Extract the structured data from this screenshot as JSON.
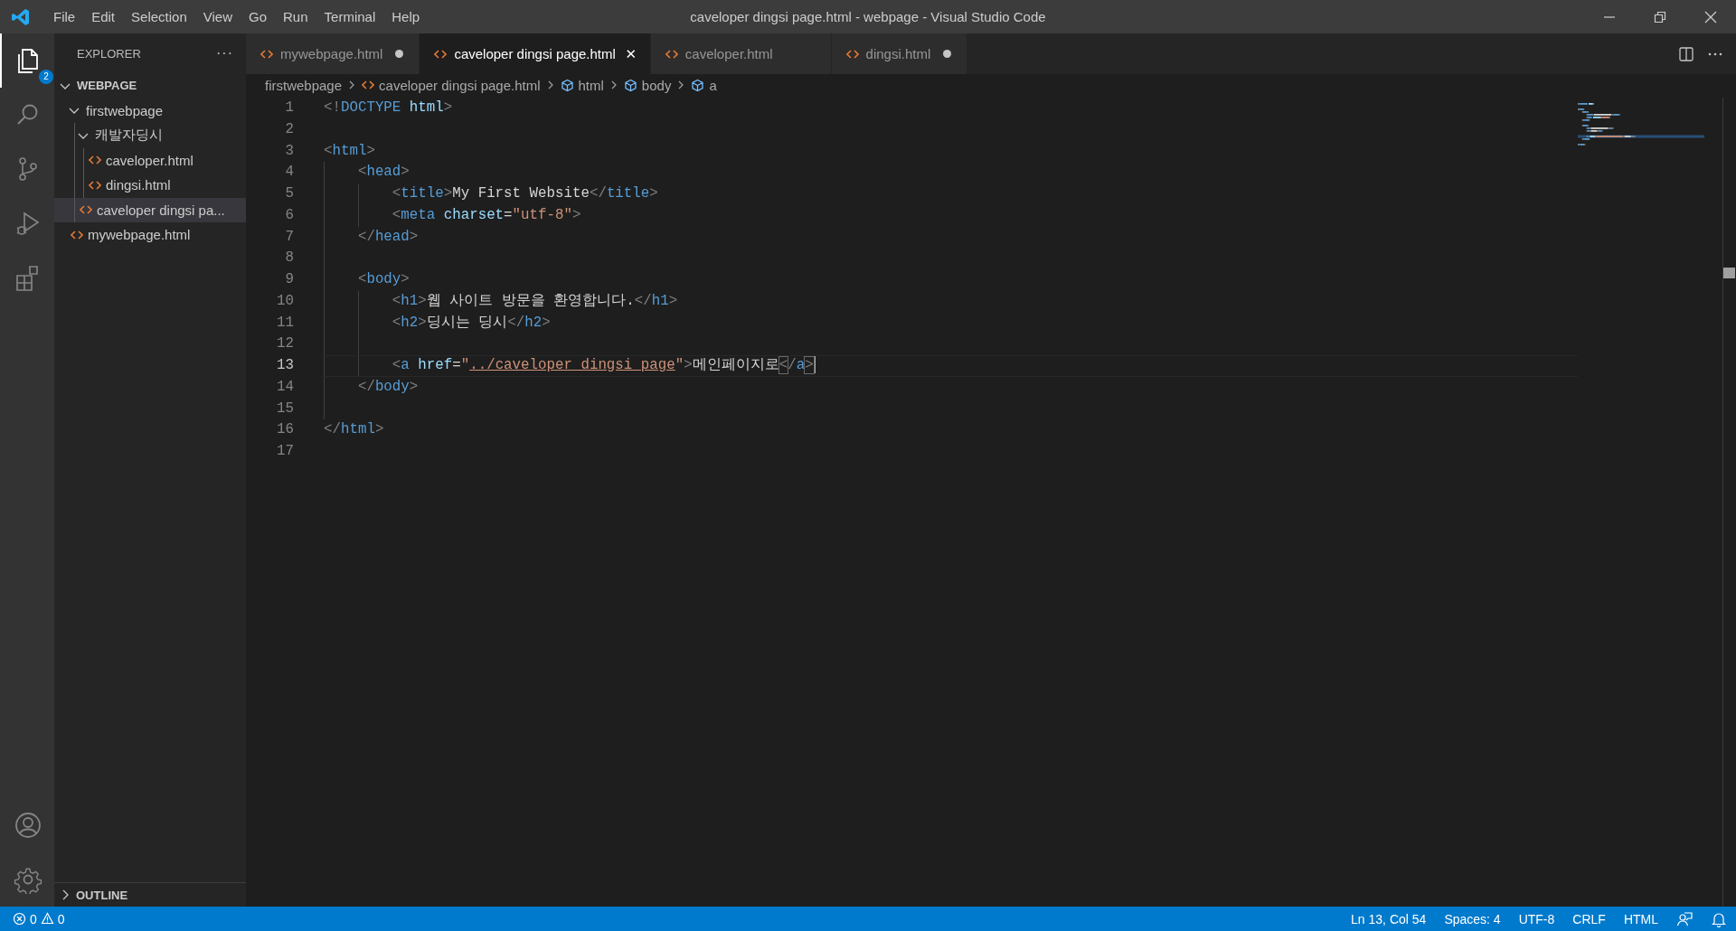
{
  "window": {
    "title": "caveloper dingsi page.html - webpage - Visual Studio Code"
  },
  "menu": [
    "File",
    "Edit",
    "Selection",
    "View",
    "Go",
    "Run",
    "Terminal",
    "Help"
  ],
  "activity_bar": {
    "top": [
      {
        "kind": "files",
        "selected": true,
        "badge": "2"
      },
      {
        "kind": "search",
        "selected": false
      },
      {
        "kind": "source-control",
        "selected": false
      },
      {
        "kind": "run",
        "selected": false
      },
      {
        "kind": "extensions",
        "selected": false
      }
    ],
    "bottom": [
      {
        "kind": "account"
      },
      {
        "kind": "settings"
      }
    ]
  },
  "sidebar": {
    "title": "EXPLORER",
    "more": "···",
    "section": {
      "label": "WEBPAGE",
      "expanded": true
    },
    "items": [
      {
        "kind": "folder",
        "label": "firstwebpage",
        "expanded": true,
        "selected": false,
        "children": [
          {
            "kind": "folder",
            "label": "캐발자딩시",
            "expanded": true,
            "selected": false,
            "children": [
              {
                "kind": "file",
                "label": "caveloper.html",
                "selected": false
              },
              {
                "kind": "file",
                "label": "dingsi.html",
                "selected": false
              }
            ]
          },
          {
            "kind": "file",
            "label": "caveloper dingsi pa...",
            "selected": true
          }
        ]
      },
      {
        "kind": "file",
        "label": "mywebpage.html",
        "selected": false
      }
    ],
    "outline": {
      "label": "OUTLINE",
      "expanded": false
    }
  },
  "tabs": [
    {
      "label": "mywebpage.html",
      "selected": false,
      "dirty": true
    },
    {
      "label": "caveloper dingsi page.html",
      "selected": true,
      "dirty": false,
      "close": "✕"
    },
    {
      "label": "caveloper.html",
      "selected": false,
      "dirty": false
    },
    {
      "label": "dingsi.html",
      "selected": false,
      "dirty": true
    }
  ],
  "breadcrumbs": [
    {
      "kind": "folder",
      "label": "firstwebpage"
    },
    {
      "kind": "file",
      "label": "caveloper dingsi page.html"
    },
    {
      "kind": "symbol",
      "label": "html"
    },
    {
      "kind": "symbol",
      "label": "body"
    },
    {
      "kind": "symbol",
      "label": "a"
    }
  ],
  "editor": {
    "lines": [
      {
        "number": "1",
        "current": false,
        "tokens": [
          {
            "kind": "punct",
            "text": "<!"
          },
          {
            "kind": "tag",
            "text": "DOCTYPE"
          },
          {
            "kind": "name",
            "text": " html"
          },
          {
            "kind": "punct",
            "text": ">"
          }
        ]
      },
      {
        "number": "2",
        "current": false
      },
      {
        "number": "3",
        "current": false,
        "tokens": [
          {
            "kind": "punct",
            "text": "<"
          },
          {
            "kind": "tag",
            "text": "html"
          },
          {
            "kind": "punct",
            "text": ">"
          }
        ]
      },
      {
        "number": "4",
        "current": false,
        "tokens": [
          {
            "kind": "punct",
            "text": "    <"
          },
          {
            "kind": "tag",
            "text": "head"
          },
          {
            "kind": "punct",
            "text": ">"
          }
        ]
      },
      {
        "number": "5",
        "current": false,
        "tokens": [
          {
            "kind": "punct",
            "text": "        <"
          },
          {
            "kind": "tag",
            "text": "title"
          },
          {
            "kind": "punct",
            "text": ">"
          },
          {
            "kind": "text",
            "text": "My First Website"
          },
          {
            "kind": "punct",
            "text": "</"
          },
          {
            "kind": "tag",
            "text": "title"
          },
          {
            "kind": "punct",
            "text": ">"
          }
        ]
      },
      {
        "number": "6",
        "current": false,
        "tokens": [
          {
            "kind": "punct",
            "text": "        <"
          },
          {
            "kind": "tag",
            "text": "meta"
          },
          {
            "kind": "attr",
            "text": " charset"
          },
          {
            "kind": "text",
            "text": "="
          },
          {
            "kind": "string",
            "text": "\"utf-8\""
          },
          {
            "kind": "punct",
            "text": ">"
          }
        ]
      },
      {
        "number": "7",
        "current": false,
        "tokens": [
          {
            "kind": "punct",
            "text": "    </"
          },
          {
            "kind": "tag",
            "text": "head"
          },
          {
            "kind": "punct",
            "text": ">"
          }
        ]
      },
      {
        "number": "8",
        "current": false
      },
      {
        "number": "9",
        "current": false,
        "tokens": [
          {
            "kind": "punct",
            "text": "    <"
          },
          {
            "kind": "tag",
            "text": "body"
          },
          {
            "kind": "punct",
            "text": ">"
          }
        ]
      },
      {
        "number": "10",
        "current": false,
        "tokens": [
          {
            "kind": "punct",
            "text": "        <"
          },
          {
            "kind": "tag",
            "text": "h1"
          },
          {
            "kind": "punct",
            "text": ">"
          },
          {
            "kind": "text",
            "text": "웹 사이트 방문을 환영합니다."
          },
          {
            "kind": "punct",
            "text": "</"
          },
          {
            "kind": "tag",
            "text": "h1"
          },
          {
            "kind": "punct",
            "text": ">"
          }
        ]
      },
      {
        "number": "11",
        "current": false,
        "tokens": [
          {
            "kind": "punct",
            "text": "        <"
          },
          {
            "kind": "tag",
            "text": "h2"
          },
          {
            "kind": "punct",
            "text": ">"
          },
          {
            "kind": "text",
            "text": "딩시는 딩시"
          },
          {
            "kind": "punct",
            "text": "</"
          },
          {
            "kind": "tag",
            "text": "h2"
          },
          {
            "kind": "punct",
            "text": ">"
          }
        ]
      },
      {
        "number": "12",
        "current": false
      },
      {
        "number": "13",
        "current": true,
        "tokens": [
          {
            "kind": "punct",
            "text": "        <"
          },
          {
            "kind": "tag",
            "text": "a"
          },
          {
            "kind": "attr",
            "text": " href"
          },
          {
            "kind": "text",
            "text": "="
          },
          {
            "kind": "string",
            "text": "\""
          },
          {
            "kind": "link",
            "text": "../caveloper dingsi page"
          },
          {
            "kind": "string",
            "text": "\""
          },
          {
            "kind": "punct",
            "text": ">"
          },
          {
            "kind": "text",
            "text": "메인페이지로"
          },
          {
            "kind": "match",
            "text": "<"
          },
          {
            "kind": "punct",
            "text": "/"
          },
          {
            "kind": "tag",
            "text": "a"
          },
          {
            "kind": "match",
            "text": ">"
          }
        ]
      },
      {
        "number": "14",
        "current": false,
        "tokens": [
          {
            "kind": "punct",
            "text": "    </"
          },
          {
            "kind": "tag",
            "text": "body"
          },
          {
            "kind": "punct",
            "text": ">"
          }
        ]
      },
      {
        "number": "15",
        "current": false
      },
      {
        "number": "16",
        "current": false,
        "tokens": [
          {
            "kind": "punct",
            "text": "</"
          },
          {
            "kind": "tag",
            "text": "html"
          },
          {
            "kind": "punct",
            "text": ">"
          }
        ]
      },
      {
        "number": "17",
        "current": false
      }
    ]
  },
  "status_bar": {
    "errors": "0",
    "warnings": "0",
    "items": [
      "Ln 13, Col 54",
      "Spaces: 4",
      "UTF-8",
      "CRLF",
      "HTML"
    ]
  }
}
